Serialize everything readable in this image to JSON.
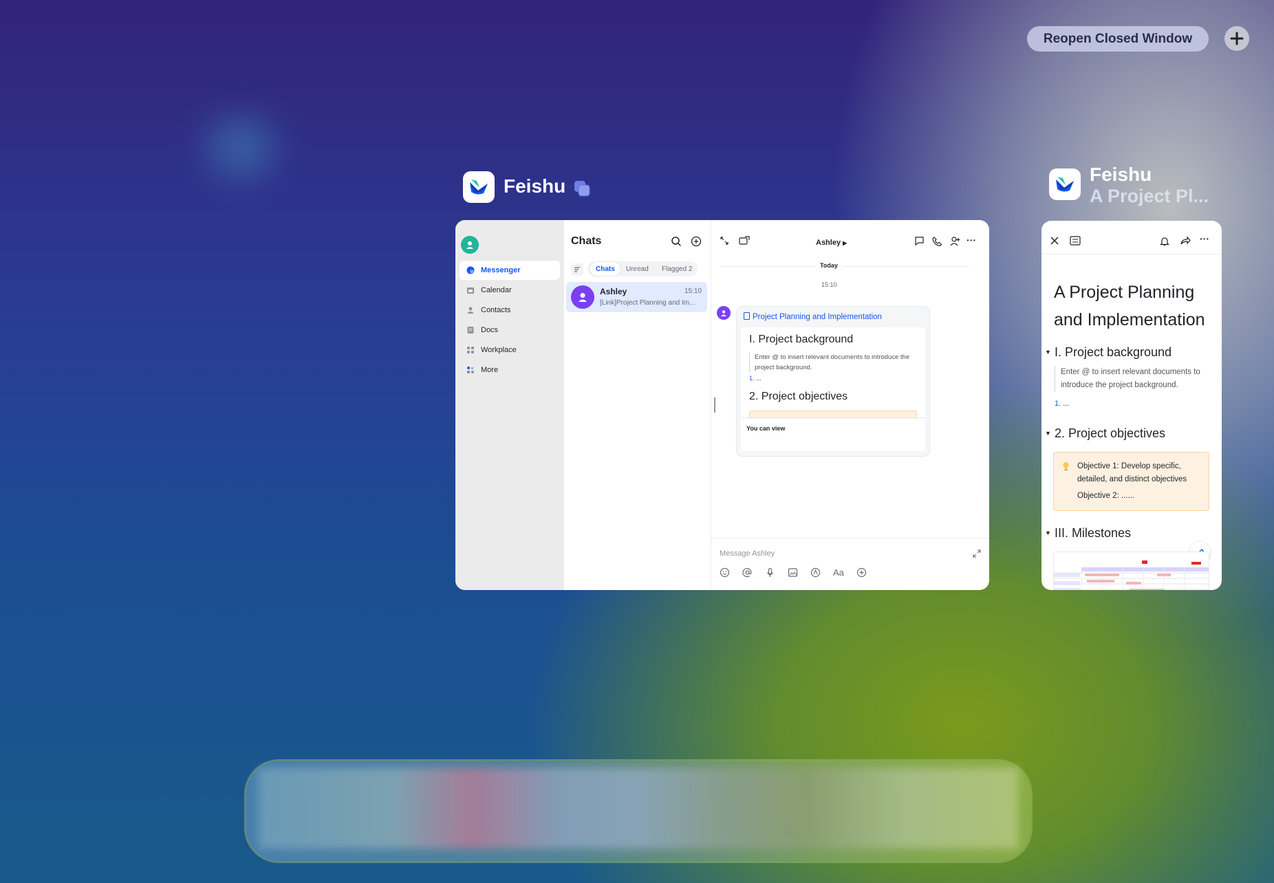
{
  "top_bar": {
    "reopen_label": "Reopen Closed Window"
  },
  "window1": {
    "app_name": "Feishu",
    "sidebar": {
      "items": [
        {
          "label": "Messenger",
          "icon": "messenger-icon"
        },
        {
          "label": "Calendar",
          "icon": "calendar-icon"
        },
        {
          "label": "Contacts",
          "icon": "contacts-icon"
        },
        {
          "label": "Docs",
          "icon": "docs-icon"
        },
        {
          "label": "Workplace",
          "icon": "workplace-icon"
        },
        {
          "label": "More",
          "icon": "more-apps-icon"
        }
      ]
    },
    "chats": {
      "title": "Chats",
      "tabs": [
        "Chats",
        "Unread",
        "Flagged 2"
      ],
      "item": {
        "name": "Ashley",
        "time": "15:10",
        "preview": "[Link]Project Planning and Im..."
      }
    },
    "conversation": {
      "title": "Ashley",
      "date_divider": "Today",
      "timestamp": "15:10",
      "card": {
        "link_title": "Project Planning and Implementation",
        "h1": "I. Project background",
        "quote": "Enter @ to insert relevant documents to introduce the project background.",
        "list_num": "1.",
        "list_text": "...",
        "h2": "2. Project objectives",
        "footer": "You can view"
      },
      "input_placeholder": "Message Ashley",
      "format_label": "Aa"
    }
  },
  "window2": {
    "app_name": "Feishu",
    "subtitle": "A Project Pl...",
    "doc": {
      "title_line1": "A Project Planning",
      "title_line2": "and Implementation",
      "h1": "I. Project background",
      "quote_line1": "Enter @ to insert relevant documents to",
      "quote_line2": "introduce the project background.",
      "list_num": "1.",
      "list_text": "...",
      "h2": "2. Project objectives",
      "callout_line1": "Objective 1: Develop specific,",
      "callout_line2": "detailed, and distinct objectives",
      "callout_line3": "Objective 2: ......",
      "h3": "III. Milestones"
    }
  },
  "colors": {
    "accent": "#1456f0",
    "avatar_green": "#23b49c",
    "avatar_purple": "#7b3ff2",
    "callout_bg": "#fef1e1"
  }
}
